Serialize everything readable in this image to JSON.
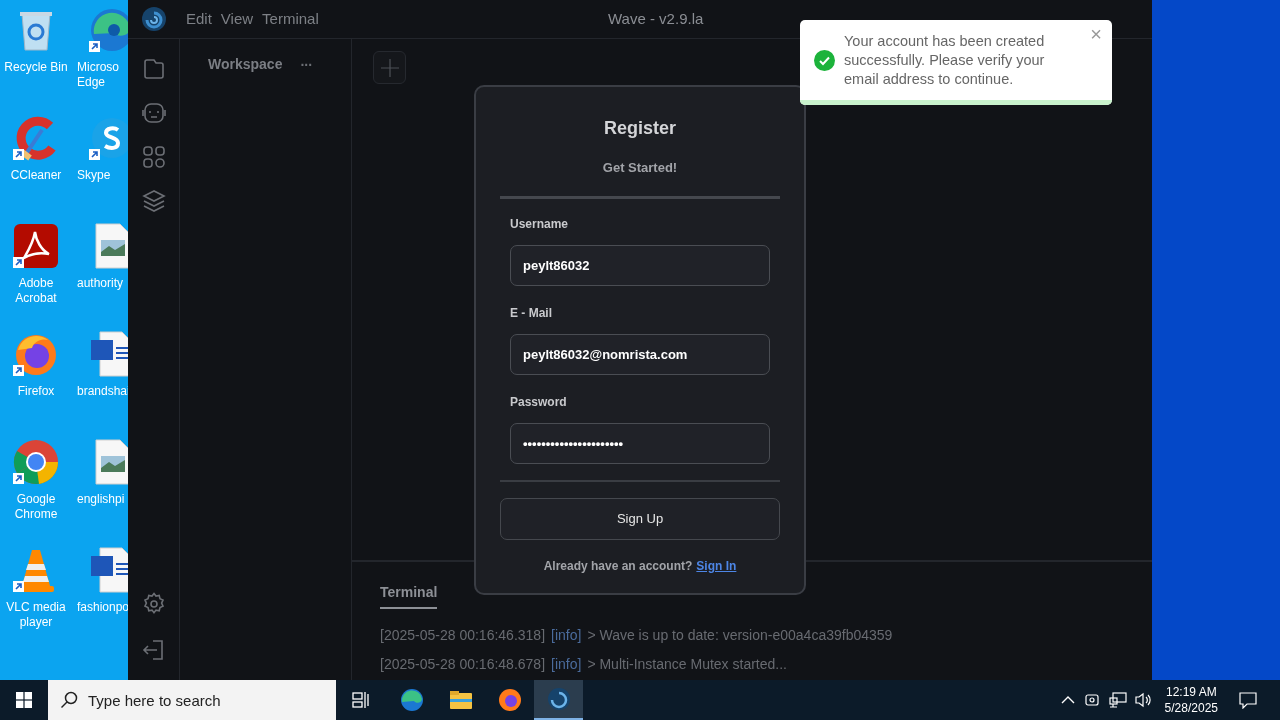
{
  "desktop": {
    "icons": [
      {
        "label": "Recycle Bin",
        "kind": "recycle",
        "shortcut": false
      },
      {
        "label": "Microso Edge",
        "kind": "edge",
        "shortcut": true
      },
      {
        "label": "CCleaner",
        "kind": "ccleaner",
        "shortcut": true
      },
      {
        "label": "Skype",
        "kind": "skype",
        "shortcut": true
      },
      {
        "label": "Adobe Acrobat",
        "kind": "acrobat",
        "shortcut": true
      },
      {
        "label": "authority",
        "kind": "image",
        "shortcut": false
      },
      {
        "label": "Firefox",
        "kind": "firefox",
        "shortcut": true
      },
      {
        "label": "brandshai",
        "kind": "word",
        "shortcut": false
      },
      {
        "label": "Google Chrome",
        "kind": "chrome",
        "shortcut": true
      },
      {
        "label": "englishpi",
        "kind": "image",
        "shortcut": false
      },
      {
        "label": "VLC media player",
        "kind": "vlc",
        "shortcut": true
      },
      {
        "label": "fashionpo",
        "kind": "word",
        "shortcut": false
      }
    ]
  },
  "app": {
    "menu": [
      "Edit",
      "View",
      "Terminal"
    ],
    "title": "Wave - v2.9.la",
    "sidebar": {
      "title": "Workspace",
      "more": "..."
    },
    "terminal": {
      "tabs": [
        {
          "label": "Terminal",
          "selected": true
        }
      ],
      "lines": [
        {
          "time": "[2025-05-28 00:16:46.318]",
          "level": "[info]",
          "message": "> Wave is up to date: version-e00a4ca39fb04359"
        },
        {
          "time": "[2025-05-28 00:16:48.678]",
          "level": "[info]",
          "message": "> Multi-Instance Mutex started..."
        }
      ]
    }
  },
  "register": {
    "title": "Register",
    "subtitle": "Get Started!",
    "fields": [
      {
        "label": "Username",
        "value": "peylt86032"
      },
      {
        "label": "E - Mail",
        "value": "peylt86032@nomrista.com"
      },
      {
        "label": "Password",
        "value": "••••••••••••••••••••••"
      }
    ],
    "submit": "Sign Up",
    "footer": "Already have an account?",
    "link": "Sign In"
  },
  "toast": {
    "message": "Your account has been created successfully. Please verify your email address to continue.",
    "close": "×",
    "level": 1
  },
  "taskbar": {
    "search_placeholder": "Type here to search",
    "apps": [
      {
        "kind": "edge",
        "selected": false
      },
      {
        "kind": "explorer",
        "selected": false
      },
      {
        "kind": "firefox",
        "selected": false
      },
      {
        "kind": "wave",
        "selected": true
      }
    ],
    "time": "12:19 AM",
    "date": "5/28/2025"
  }
}
